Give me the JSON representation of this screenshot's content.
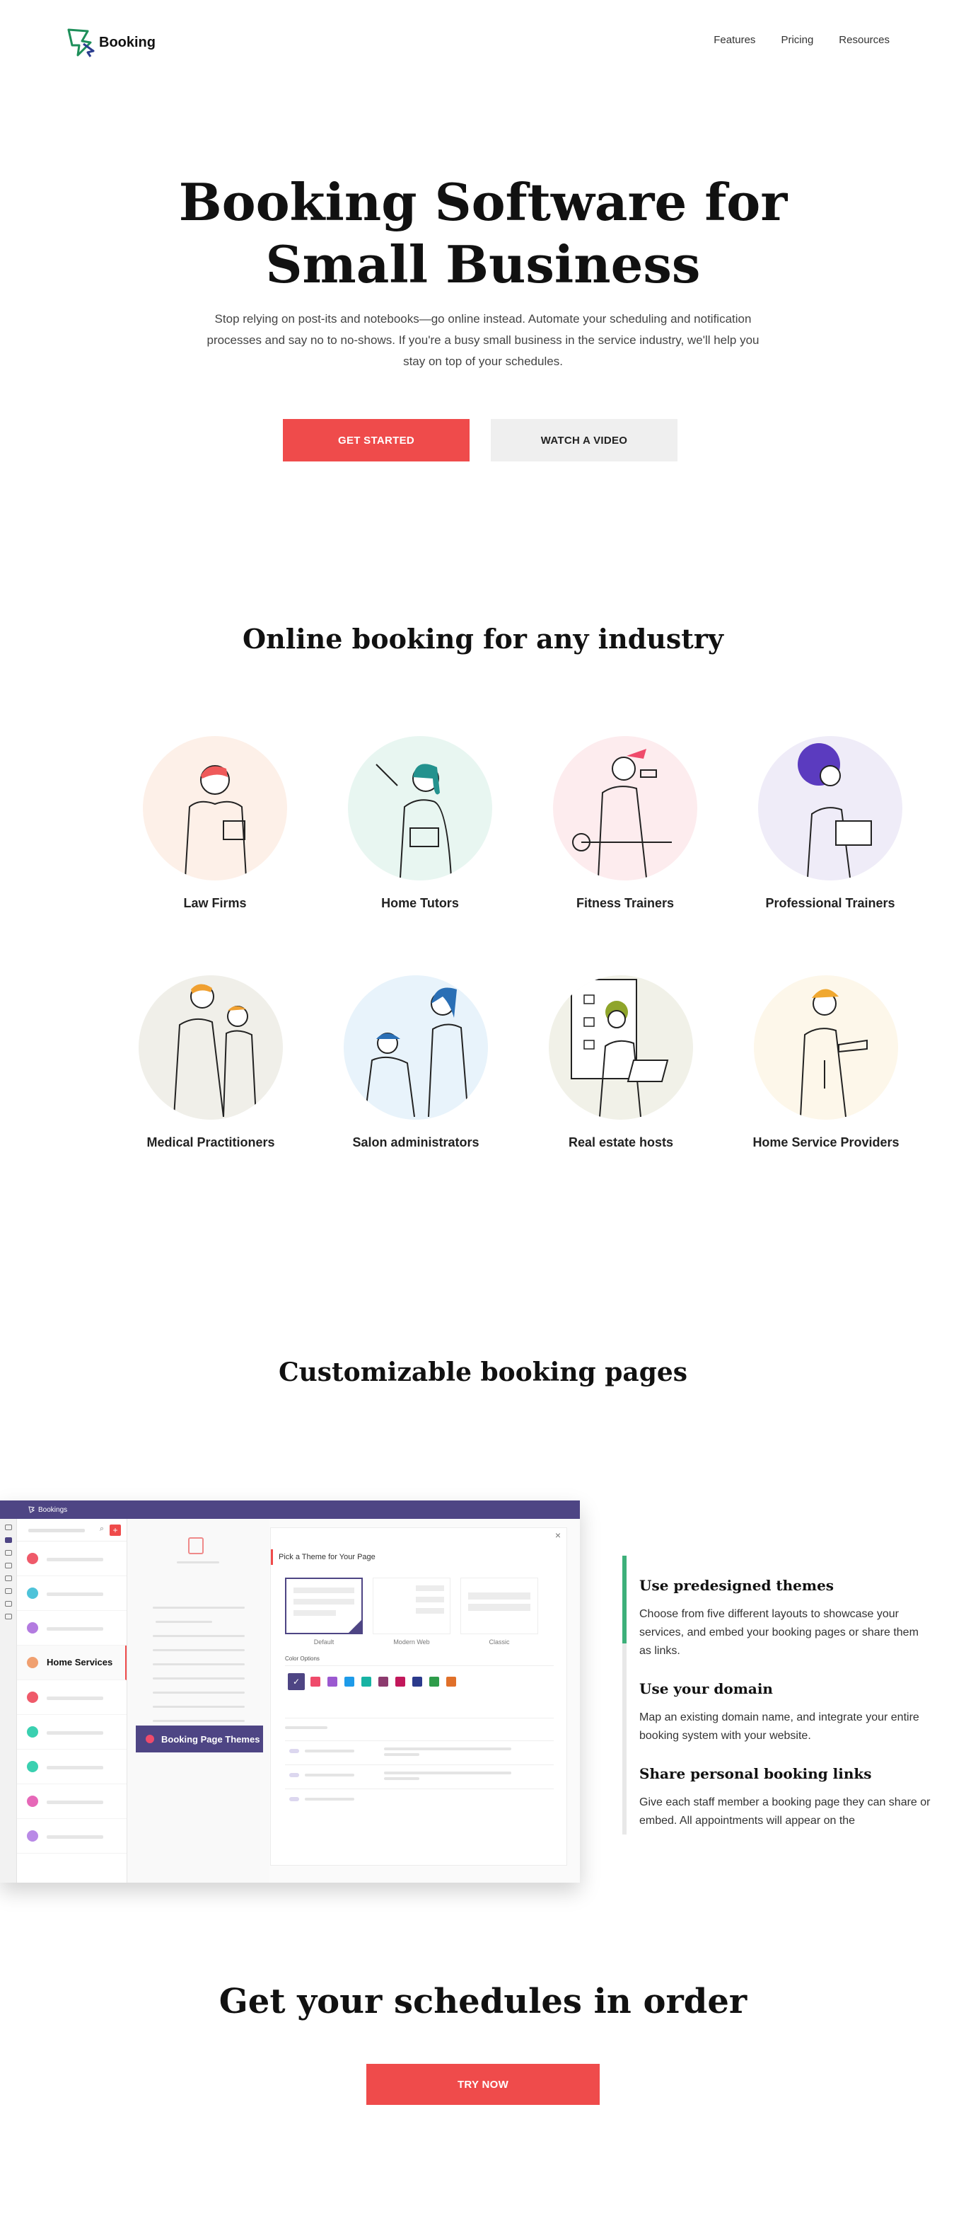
{
  "header": {
    "logo_text": "Booking",
    "nav": [
      "Features",
      "Pricing",
      "Resources"
    ]
  },
  "hero": {
    "title_line1": "Booking Software for",
    "title_line2": "Small Business",
    "subtitle": "Stop relying on post-its and notebooks—go online instead. Automate your scheduling and notification processes and say no to no-shows. If you're a busy small business in the service industry, we'll help you stay on top of your schedules.",
    "primary_cta": "GET STARTED",
    "secondary_cta": "WATCH A VIDEO"
  },
  "industries": {
    "title": "Online booking for any industry",
    "items": [
      {
        "label": "Law Firms",
        "bg": "#fdf0e8",
        "accent": "#ef5a5a"
      },
      {
        "label": "Home Tutors",
        "bg": "#e8f6f1",
        "accent": "#23928e"
      },
      {
        "label": "Fitness Trainers",
        "bg": "#fdecee",
        "accent": "#ef4b6b"
      },
      {
        "label": "Professional Trainers",
        "bg": "#efecf8",
        "accent": "#5b3bbf"
      },
      {
        "label": "Medical Practitioners",
        "bg": "#f0efe9",
        "accent": "#f0a030"
      },
      {
        "label": "Salon administrators",
        "bg": "#e8f3fb",
        "accent": "#2a6fb5"
      },
      {
        "label": "Real estate hosts",
        "bg": "#f1f1e8",
        "accent": "#8fa52b"
      },
      {
        "label": "Home Service Providers",
        "bg": "#fdf7ea",
        "accent": "#f0a830"
      }
    ]
  },
  "pages": {
    "title": "Customizable booking pages",
    "app": {
      "brand": "Bookings",
      "list_active": "Home Services",
      "list_dots": [
        "#ef5a6a",
        "#4ec3d9",
        "#b37be0",
        "#f0a070",
        "#ef5a6a",
        "#3ad0b0",
        "#3ad0b0",
        "#e668b8",
        "#b98ae6"
      ],
      "theme_button": "Booking Page Themes",
      "modal_title": "Pick a Theme for Your Page",
      "themes": [
        "Default",
        "Modern Web",
        "Classic"
      ],
      "color_label": "Color Options",
      "swatches": [
        "#4e4584",
        "#ef4b6b",
        "#9b59d0",
        "#1e9be9",
        "#17b3a3",
        "#8c3b6e",
        "#c2185b",
        "#2b3a8c",
        "#2e9c4a",
        "#e0702a"
      ]
    },
    "features": [
      {
        "title": "Use predesigned themes",
        "text": "Choose from five different layouts to showcase your services, and embed your booking pages or share them as links."
      },
      {
        "title": "Use your domain",
        "text": "Map an existing domain name, and integrate your entire booking system with your website."
      },
      {
        "title": "Share personal booking links",
        "text": "Give each staff member a booking page they can share or embed. All appointments will appear on the"
      }
    ]
  },
  "cta": {
    "title": "Get your schedules in order",
    "button": "TRY NOW"
  },
  "colors": {
    "accent": "#ef4b4b",
    "brand": "#4e4584",
    "success": "#3db07a"
  }
}
